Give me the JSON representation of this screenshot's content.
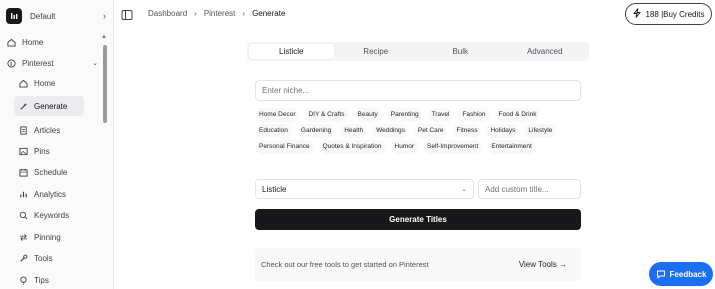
{
  "workspace": {
    "name": "Default",
    "chevron": "›"
  },
  "sidebar": {
    "items": [
      {
        "label": "Home",
        "icon": "home-icon"
      },
      {
        "label": "Pinterest",
        "icon": "pinterest-icon"
      },
      {
        "label": "Home",
        "icon": "home-icon"
      },
      {
        "label": "Generate",
        "icon": "wand-icon"
      },
      {
        "label": "Articles",
        "icon": "document-icon"
      },
      {
        "label": "Pins",
        "icon": "image-icon"
      },
      {
        "label": "Schedule",
        "icon": "calendar-icon"
      },
      {
        "label": "Analytics",
        "icon": "chart-icon"
      },
      {
        "label": "Keywords",
        "icon": "search-icon"
      },
      {
        "label": "Pinning",
        "icon": "arrows-icon"
      },
      {
        "label": "Tools",
        "icon": "wrench-icon"
      },
      {
        "label": "Tips",
        "icon": "bulb-icon"
      }
    ]
  },
  "breadcrumb": {
    "items": [
      "Dashboard",
      "Pinterest",
      "Generate"
    ],
    "separator": "›"
  },
  "credits": {
    "label": "188 |Buy Credits"
  },
  "tabs": [
    "Listicle",
    "Recipe",
    "Bulk",
    "Advanced"
  ],
  "niche": {
    "placeholder": "Enter niche..."
  },
  "chips": [
    "Home Decor",
    "DIY & Crafts",
    "Beauty",
    "Parenting",
    "Travel",
    "Fashion",
    "Food & Drink",
    "Education",
    "Gardening",
    "Health",
    "Weddings",
    "Pet Care",
    "Fitness",
    "Holidays",
    "Lifestyle",
    "Personal Finance",
    "Quotes & Inspiration",
    "Humor",
    "Self-Improvement",
    "Entertainment"
  ],
  "type_select": {
    "value": "Listicle",
    "chevron": "⌄"
  },
  "custom_title": {
    "placeholder": "Add custom title..."
  },
  "generate_button": {
    "label": "Generate Titles"
  },
  "tools_banner": {
    "message": "Check out our free tools to get started on Pinterest",
    "link": "View Tools →"
  },
  "feedback": {
    "label": "Feedback"
  },
  "colors": {
    "accent": "#1d6ff2",
    "primary": "#18181b"
  }
}
